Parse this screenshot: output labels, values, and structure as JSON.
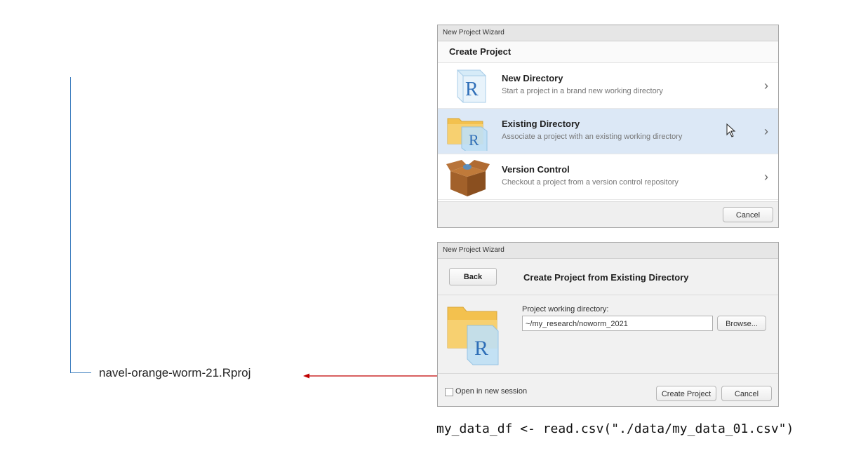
{
  "tree": {
    "file_name": "navel-orange-worm-21.Rproj"
  },
  "wizard1": {
    "window_title": "New Project Wizard",
    "header": "Create Project",
    "options": [
      {
        "title": "New Directory",
        "description": "Start a project in a brand new working directory",
        "icon": "r-cube-icon",
        "selected": false
      },
      {
        "title": "Existing Directory",
        "description": "Associate a project with an existing working directory",
        "icon": "folder-r-icon",
        "selected": true
      },
      {
        "title": "Version Control",
        "description": "Checkout a project from a version control repository",
        "icon": "box-icon",
        "selected": false
      }
    ],
    "chevron": "›",
    "cancel_label": "Cancel"
  },
  "wizard2": {
    "window_title": "New Project Wizard",
    "back_label": "Back",
    "heading": "Create Project from Existing Directory",
    "dir_label": "Project working directory:",
    "dir_value": "~/my_research/noworm_2021",
    "browse_label": "Browse...",
    "checkbox_label": "Open in new session",
    "checkbox_checked": false,
    "create_label": "Create Project",
    "cancel_label": "Cancel"
  },
  "code_line": "my_data_df <- read.csv(\"./data/my_data_01.csv\")",
  "colors": {
    "tree_line": "#3f7fbf",
    "arrow": "#c00000",
    "selected_row": "#dce8f6",
    "r_logo": "#2f6fb8"
  }
}
